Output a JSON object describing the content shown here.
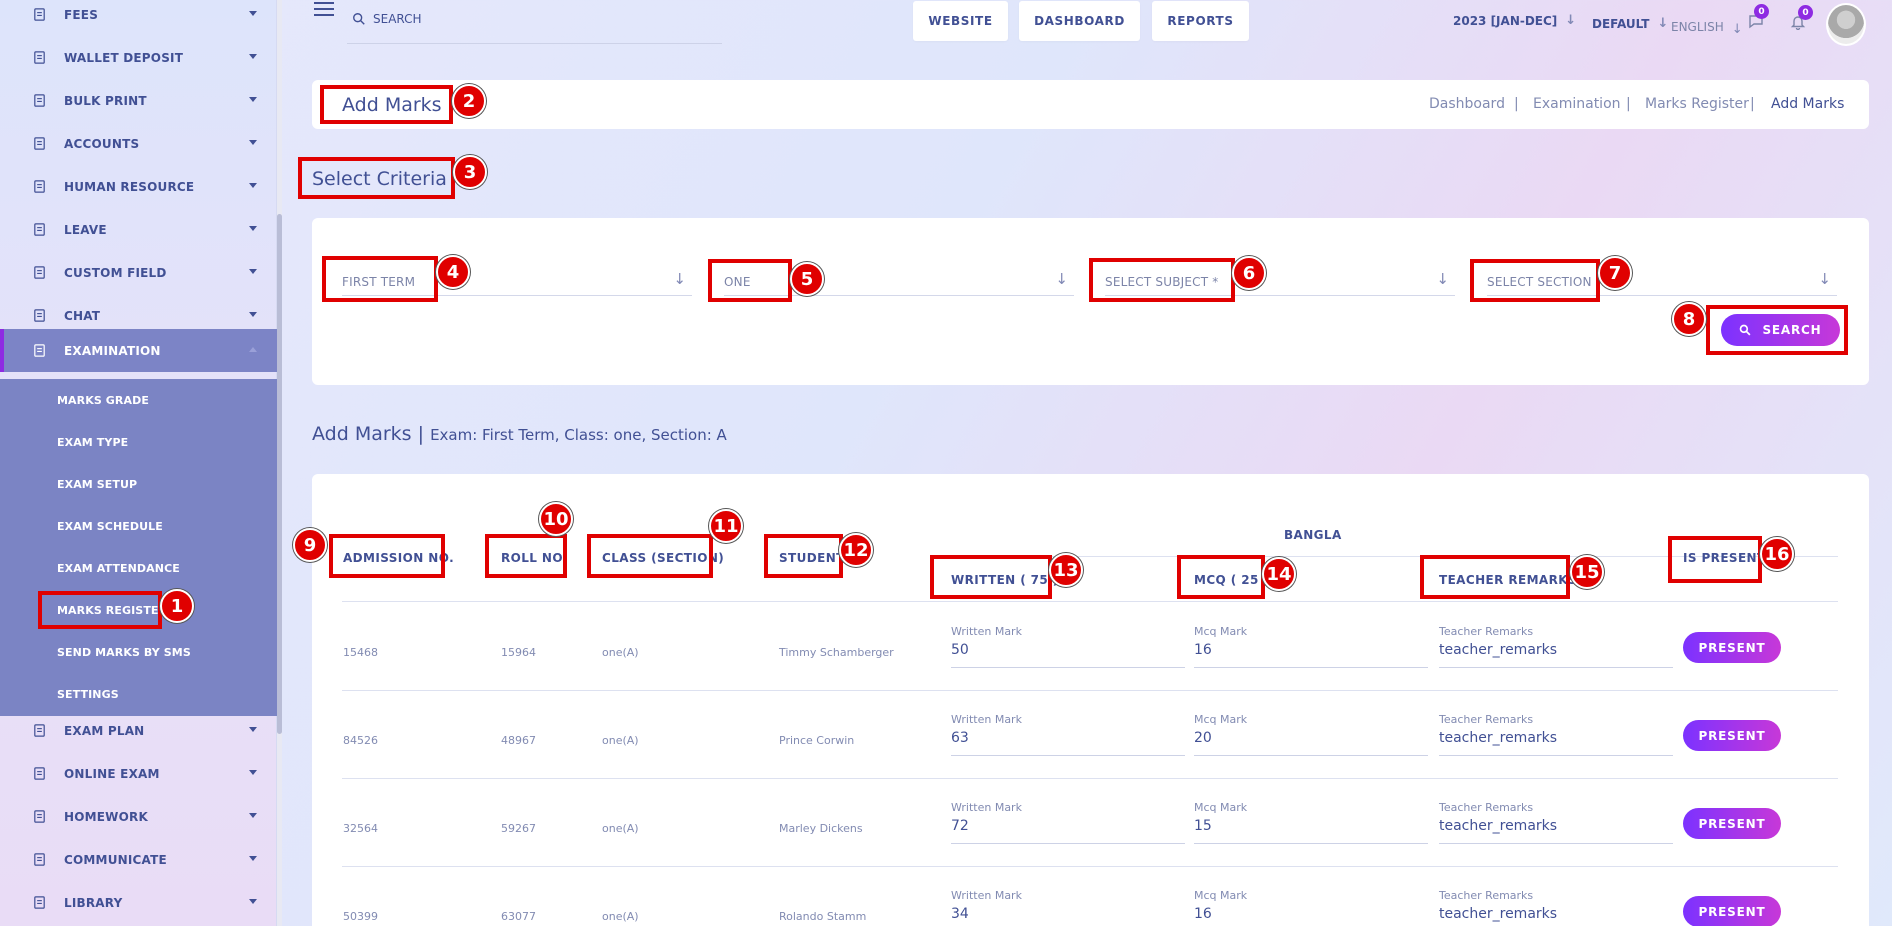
{
  "sidebar": {
    "items": [
      {
        "label": "FEES",
        "icon": "fees-icon"
      },
      {
        "label": "WALLET DEPOSIT",
        "icon": "wallet-icon"
      },
      {
        "label": "BULK PRINT",
        "icon": "print-icon"
      },
      {
        "label": "ACCOUNTS",
        "icon": "accounts-icon"
      },
      {
        "label": "HUMAN RESOURCE",
        "icon": "human-resource-icon"
      },
      {
        "label": "LEAVE",
        "icon": "leave-icon"
      },
      {
        "label": "CUSTOM FIELD",
        "icon": "custom-field-icon"
      },
      {
        "label": "CHAT",
        "icon": "chat-icon"
      },
      {
        "label": "EXAMINATION",
        "icon": "examination-icon"
      },
      {
        "label": "EXAM PLAN",
        "icon": "exam-plan-icon"
      },
      {
        "label": "ONLINE EXAM",
        "icon": "online-exam-icon"
      },
      {
        "label": "HOMEWORK",
        "icon": "homework-icon"
      },
      {
        "label": "COMMUNICATE",
        "icon": "communicate-icon"
      },
      {
        "label": "LIBRARY",
        "icon": "library-icon"
      }
    ],
    "examination_submenu": [
      "MARKS GRADE",
      "EXAM TYPE",
      "EXAM SETUP",
      "EXAM SCHEDULE",
      "EXAM ATTENDANCE",
      "MARKS REGISTER",
      "SEND MARKS BY SMS",
      "SETTINGS"
    ]
  },
  "topbar": {
    "search_placeholder": "SEARCH",
    "buttons": [
      "WEBSITE",
      "DASHBOARD",
      "REPORTS"
    ],
    "session": "2023 [JAN-DEC]",
    "theme": "DEFAULT",
    "language": "ENGLISH",
    "messages_count": "0",
    "notifications_count": "0"
  },
  "page": {
    "title": "Add Marks",
    "breadcrumb": [
      "Dashboard",
      "Examination",
      "Marks Register",
      "Add Marks"
    ],
    "breadcrumb_sep": "|"
  },
  "criteria": {
    "title": "Select Criteria",
    "exam": "FIRST TERM",
    "class": "ONE",
    "subject": "SELECT SUBJECT *",
    "section": "SELECT SECTION",
    "search_label": "SEARCH"
  },
  "marks": {
    "heading": "Add Marks |",
    "details": "Exam: First Term, Class: one, Section: A",
    "subject_group": "BANGLA",
    "columns": {
      "admission": "ADMISSION NO.",
      "roll": "ROLL NO.",
      "class": "CLASS (SECTION)",
      "student": "STUDENT",
      "written": "WRITTEN ( 75 )",
      "mcq": "MCQ ( 25 )",
      "remarks": "TEACHER REMARKS",
      "present": "IS PRESENT"
    },
    "field_labels": {
      "written": "Written Mark",
      "mcq": "Mcq Mark",
      "remarks": "Teacher Remarks"
    },
    "present_label": "PRESENT",
    "rows": [
      {
        "admission": "15468",
        "roll": "15964",
        "class": "one(A)",
        "student": "Timmy Schamberger",
        "written": "50",
        "mcq": "16",
        "remarks": "teacher_remarks"
      },
      {
        "admission": "84526",
        "roll": "48967",
        "class": "one(A)",
        "student": "Prince Corwin",
        "written": "63",
        "mcq": "20",
        "remarks": "teacher_remarks"
      },
      {
        "admission": "32564",
        "roll": "59267",
        "class": "one(A)",
        "student": "Marley Dickens",
        "written": "72",
        "mcq": "15",
        "remarks": "teacher_remarks"
      },
      {
        "admission": "50399",
        "roll": "63077",
        "class": "one(A)",
        "student": "Rolando Stamm",
        "written": "34",
        "mcq": "16",
        "remarks": "teacher_remarks"
      }
    ]
  },
  "annotations": [
    "1",
    "2",
    "3",
    "4",
    "5",
    "6",
    "7",
    "8",
    "9",
    "10",
    "11",
    "12",
    "13",
    "14",
    "15",
    "16"
  ],
  "colors": {
    "accent": "#7c32ff",
    "accent2": "#c738d8",
    "text": "#415094",
    "highlight_box": "#e00000"
  }
}
